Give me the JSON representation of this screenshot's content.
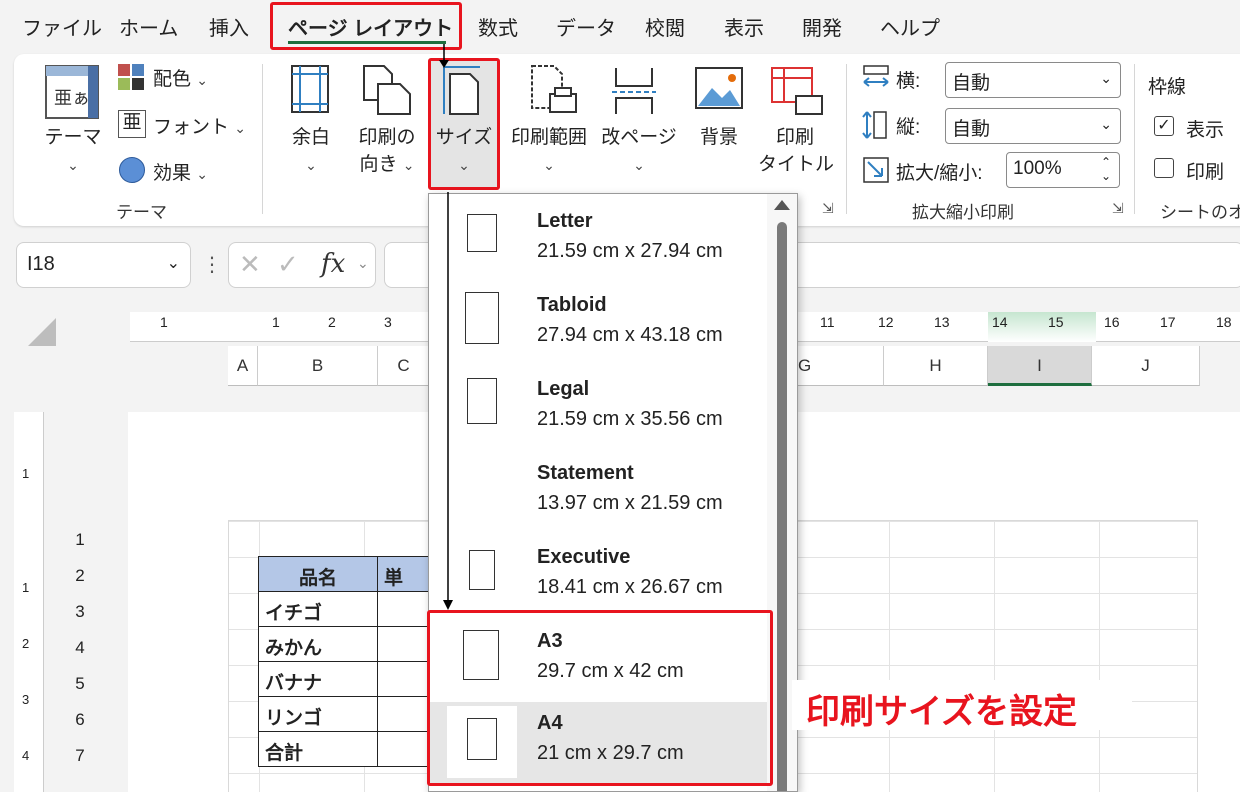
{
  "tabs": [
    "ファイル",
    "ホーム",
    "挿入",
    "ページ レイアウト",
    "数式",
    "データ",
    "校閲",
    "表示",
    "開発",
    "ヘルプ"
  ],
  "active_tab": "ページ レイアウト",
  "ribbon": {
    "theme": "テーマ",
    "colors": "配色",
    "fonts": "フォント",
    "effects": "効果",
    "theme_group": "テーマ",
    "margins": "余白",
    "orientation_1": "印刷の",
    "orientation_2": "向き",
    "size": "サイズ",
    "print_area": "印刷範囲",
    "breaks": "改ページ",
    "background": "背景",
    "print_titles_1": "印刷",
    "print_titles_2": "タイトル",
    "width_label": "横:",
    "width_value": "自動",
    "height_label": "縦:",
    "height_value": "自動",
    "scale_label": "拡大/縮小:",
    "scale_value": "100%",
    "scale_group": "拡大縮小印刷",
    "gridlines": "枠線",
    "view": "表示",
    "print": "印刷",
    "sheet_options_group": "シートのオ"
  },
  "formula_bar": {
    "name_box": "I18",
    "fx": "fx"
  },
  "ruler_top": [
    "1",
    "1",
    "2",
    "3",
    "11",
    "12",
    "13",
    "14",
    "15",
    "16",
    "17",
    "18"
  ],
  "columns": [
    "A",
    "B",
    "C",
    "G",
    "H",
    "I",
    "J"
  ],
  "rows": [
    "1",
    "2",
    "3",
    "4",
    "5",
    "6",
    "7"
  ],
  "ruler_left": [
    "1",
    "1",
    "2",
    "3",
    "4"
  ],
  "table": {
    "header_1": "品名",
    "header_2": "単",
    "items": [
      "イチゴ",
      "みかん",
      "バナナ",
      "リンゴ",
      "合計"
    ]
  },
  "dropdown": {
    "items": [
      {
        "name": "Letter",
        "dims": "21.59 cm x 27.94 cm"
      },
      {
        "name": "Tabloid",
        "dims": "27.94 cm x 43.18 cm"
      },
      {
        "name": "Legal",
        "dims": "21.59 cm x 35.56 cm"
      },
      {
        "name": "Statement",
        "dims": "13.97 cm x 21.59 cm"
      },
      {
        "name": "Executive",
        "dims": "18.41 cm x 26.67 cm"
      },
      {
        "name": "A3",
        "dims": "29.7 cm x 42 cm"
      },
      {
        "name": "A4",
        "dims": "21 cm x 29.7 cm"
      }
    ],
    "selected": "A4"
  },
  "annotation": "印刷サイズを設定",
  "colors": {
    "accent_red": "#e8141e",
    "tab_underline": "#1e6e3e",
    "table_header": "#b4c7e7",
    "selected_column": "#d9d9d9"
  }
}
